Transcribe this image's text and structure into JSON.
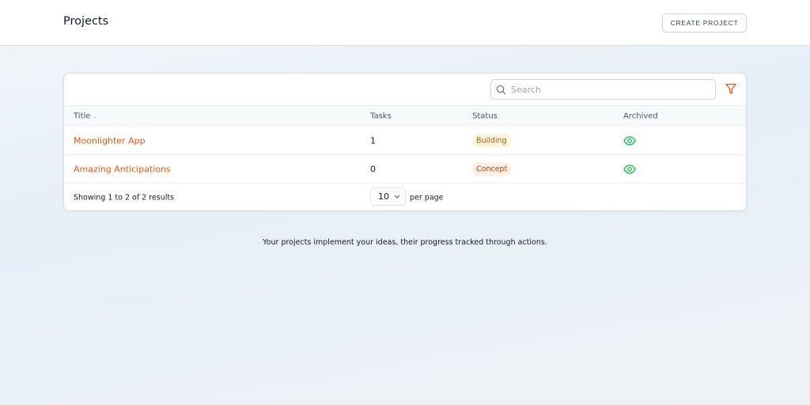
{
  "header": {
    "title": "Projects",
    "create_label": "CREATE PROJECT"
  },
  "toolbar": {
    "search_placeholder": "Search",
    "search_value": ""
  },
  "table": {
    "columns": [
      "Title",
      "Tasks",
      "Status",
      "Archived"
    ],
    "rows": [
      {
        "title": "Moonlighter App",
        "tasks": "1",
        "status": "Building",
        "archived_icon": "eye-icon"
      },
      {
        "title": "Amazing Anticipations",
        "tasks": "0",
        "status": "Concept",
        "archived_icon": "eye-icon"
      }
    ]
  },
  "pagination": {
    "summary": "Showing 1 to 2 of 2 results",
    "per_page_value": "10",
    "per_page_label": "per page"
  },
  "note": "Your projects implement your ideas, their progress tracked through actions.",
  "colors": {
    "accent": "#ea580c",
    "archived": "#22c55e"
  }
}
